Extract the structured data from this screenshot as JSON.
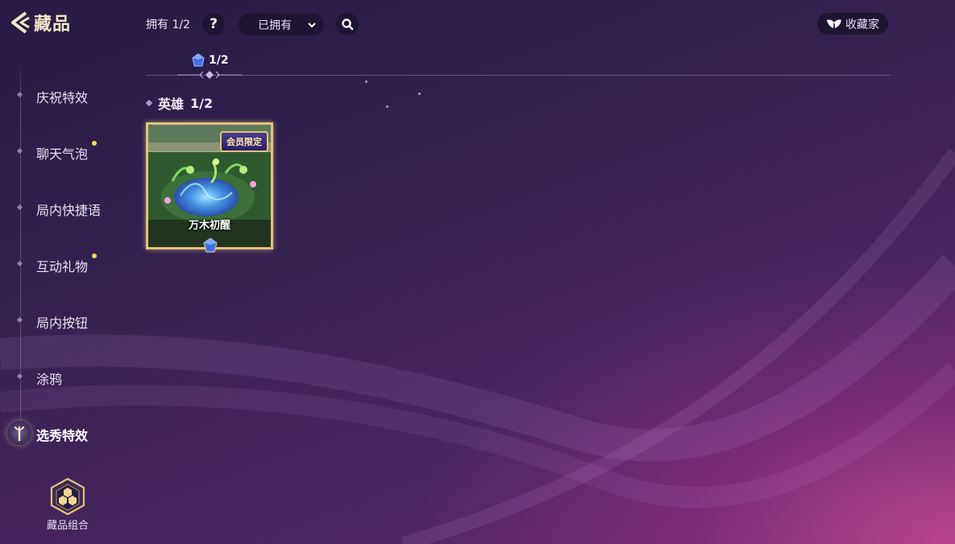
{
  "header": {
    "title": "藏品",
    "owned_label": "拥有 1/2",
    "help_label": "?",
    "filter": {
      "selected": "已拥有"
    },
    "collector_label": "收藏家"
  },
  "progress": {
    "count": "1/2"
  },
  "sidebar": {
    "items": [
      {
        "label": "庆祝特效",
        "notice": false
      },
      {
        "label": "聊天气泡",
        "notice": true
      },
      {
        "label": "局内快捷语",
        "notice": false
      },
      {
        "label": "互动礼物",
        "notice": true
      },
      {
        "label": "局内按钮",
        "notice": false
      },
      {
        "label": "涂鸦",
        "notice": false
      },
      {
        "label": "选秀特效",
        "notice": false,
        "active": true
      }
    ],
    "combo_label": "藏品组合"
  },
  "section": {
    "title": "英雄",
    "count": "1/2"
  },
  "cards": [
    {
      "name": "万木初醒",
      "badge": "会员限定"
    }
  ],
  "colors": {
    "accent_gold": "#e2c27a",
    "notice_dot": "#ffd84a",
    "control_bg": "#1e1533"
  },
  "icons": {
    "back": "chevron-left-icon",
    "search": "search-icon",
    "collector": "wings-icon",
    "gem": "blue-gem-icon",
    "active_item": "sword-icon",
    "combo": "hexagon-cluster-icon"
  }
}
